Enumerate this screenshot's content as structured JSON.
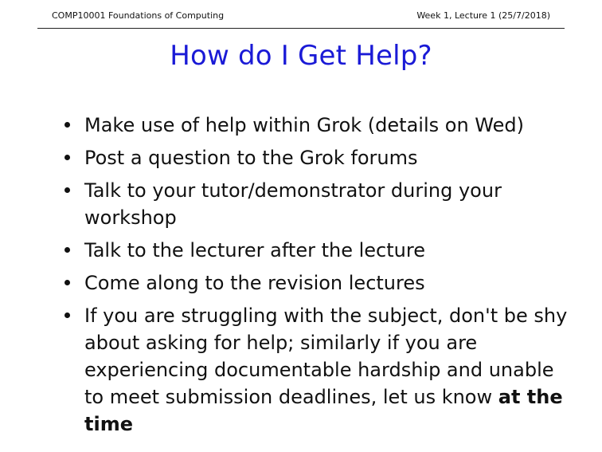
{
  "header": {
    "course": "COMP10001 Foundations of Computing",
    "lecture": "Week 1, Lecture 1 (25/7/2018)"
  },
  "slide": {
    "title": "How do I Get Help?",
    "bullets": [
      "Make use of help within Grok (details on Wed)",
      "Post a question to the Grok forums",
      "Talk to your tutor/demonstrator during your workshop",
      "Talk to the lecturer after the lecture",
      "Come along to the revision lectures"
    ],
    "last_bullet": {
      "text": "If you are struggling with the subject, don't be shy about asking for help; similarly if you are experiencing documentable hardship and unable to meet submission deadlines, let us know ",
      "emphasis": "at the time"
    }
  }
}
